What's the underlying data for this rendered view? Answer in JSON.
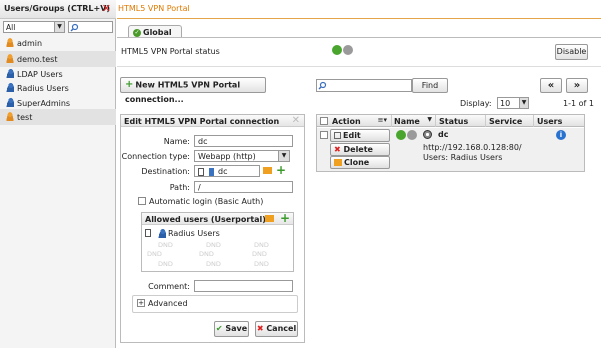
{
  "sidebar": {
    "title": "Users/Groups (CTRL+V)",
    "filter_value": "All",
    "items": [
      {
        "label": "admin",
        "type": "user"
      },
      {
        "label": "demo.test",
        "type": "user"
      },
      {
        "label": "LDAP Users",
        "type": "group"
      },
      {
        "label": "Radius Users",
        "type": "group"
      },
      {
        "label": "SuperAdmins",
        "type": "group"
      },
      {
        "label": "test",
        "type": "user"
      }
    ]
  },
  "header": {
    "title": "HTML5 VPN Portal",
    "tab": "Global"
  },
  "status": {
    "label": "HTML5 VPN Portal status",
    "disable_label": "Disable"
  },
  "toolbar": {
    "new_label": "New HTML5 VPN Portal connection...",
    "find_label": "Find",
    "prev": "«",
    "next": "»",
    "display_label": "Display:",
    "display_value": "10",
    "range": "1-1 of 1"
  },
  "edit": {
    "title": "Edit HTML5 VPN Portal connection",
    "name_label": "Name:",
    "name_value": "dc",
    "conn_type_label": "Connection type:",
    "conn_type_value": "Webapp (http)",
    "destination_label": "Destination:",
    "destination_value": "dc",
    "path_label": "Path:",
    "path_value": "/",
    "autologin_label": "Automatic login (Basic Auth)",
    "allowed_title": "Allowed users (Userportal)",
    "allowed_item": "Radius Users",
    "dnd": "DND",
    "comment_label": "Comment:",
    "advanced_label": "Advanced",
    "save_label": "Save",
    "cancel_label": "Cancel"
  },
  "table": {
    "columns": [
      "Action",
      "Name",
      "Status",
      "Service",
      "Users"
    ],
    "row": {
      "edit": "Edit",
      "delete": "Delete",
      "clone": "Clone",
      "name": "dc",
      "url": "http://192.168.0.128:80/",
      "users": "Users: Radius Users"
    }
  },
  "colors": {
    "accent": "#e07a00",
    "green": "#4a9a2a",
    "red": "#d22222"
  }
}
